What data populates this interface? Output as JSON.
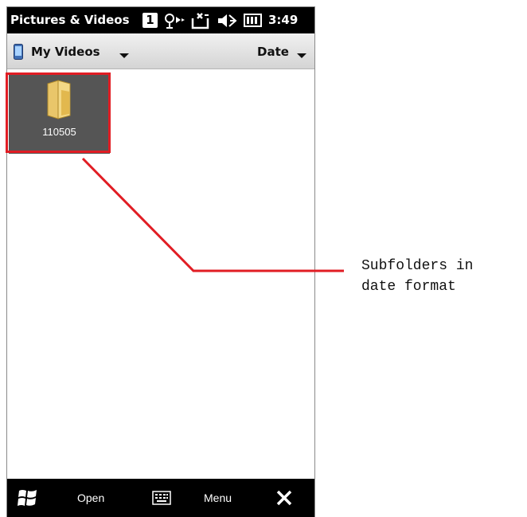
{
  "titlebar": {
    "app_title": "Pictures & Videos",
    "notification_count": "1",
    "clock": "3:49",
    "icons": [
      "signal-icon",
      "sync-icon",
      "speaker-mute-icon",
      "battery-icon"
    ]
  },
  "navbar": {
    "folder_label": "My Videos",
    "sort_label": "Date"
  },
  "content": {
    "folders": [
      {
        "name": "110505",
        "icon": "folder-icon",
        "selected": true
      }
    ]
  },
  "softkeys": {
    "open_label": "Open",
    "menu_label": "Menu",
    "icons": [
      "windows-start-icon",
      "keyboard-icon",
      "close-icon"
    ]
  },
  "annotation": {
    "callout_text": "Subfolders in\ndate format",
    "color": "#e11d24"
  }
}
